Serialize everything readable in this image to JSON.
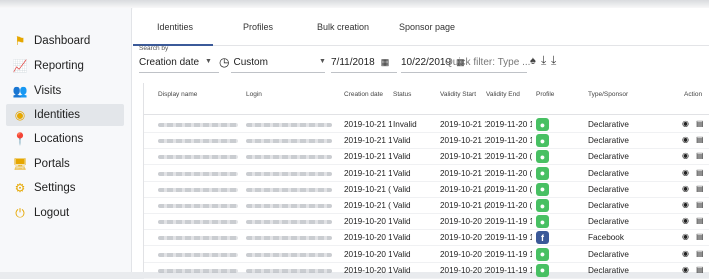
{
  "sidebar": {
    "items": [
      {
        "label": "Dashboard",
        "icon": "dashboard-icon",
        "glyph": "⚑",
        "color": "#e6a700"
      },
      {
        "label": "Reporting",
        "icon": "chart-icon",
        "glyph": "📈",
        "color": "#e6a700"
      },
      {
        "label": "Visits",
        "icon": "people-icon",
        "glyph": "👥",
        "color": "#e6a700"
      },
      {
        "label": "Identities",
        "icon": "fingerprint-icon",
        "glyph": "◉",
        "color": "#e6a700",
        "active": true
      },
      {
        "label": "Locations",
        "icon": "location-pin-icon",
        "glyph": "📍",
        "color": "#e6a700"
      },
      {
        "label": "Portals",
        "icon": "portal-icon",
        "glyph": "🖥",
        "color": "#e6a700"
      },
      {
        "label": "Settings",
        "icon": "gear-icon",
        "glyph": "⚙",
        "color": "#e6a700"
      },
      {
        "label": "Logout",
        "icon": "power-icon",
        "glyph": "⏻",
        "color": "#e6a700"
      }
    ]
  },
  "tabs": [
    "Identities",
    "Profiles",
    "Bulk creation",
    "Sponsor page"
  ],
  "filters": {
    "search_by_label": "Search by",
    "search_by_value": "Creation date",
    "period_value": "Custom",
    "start_date": "7/11/2018",
    "end_date": "10/22/2019",
    "quick_filter_placeholder": "Quick filter: Type ..."
  },
  "table": {
    "headers": [
      "Display name",
      "Login",
      "Creation date",
      "Status",
      "Validity Start",
      "Validity End",
      "Profile",
      "Type/Sponsor",
      "Action"
    ],
    "rows": [
      {
        "creation": "2019-10-21 1",
        "status": "Invalid",
        "vstart": "2019-10-21 1",
        "vend": "2019-11-20 1",
        "profile": "declarative",
        "type": "Declarative"
      },
      {
        "creation": "2019-10-21 1",
        "status": "Valid",
        "vstart": "2019-10-21 1",
        "vend": "2019-11-20 1",
        "profile": "declarative",
        "type": "Declarative"
      },
      {
        "creation": "2019-10-21 1",
        "status": "Valid",
        "vstart": "2019-10-21 1",
        "vend": "2019-11-20 (",
        "profile": "declarative",
        "type": "Declarative"
      },
      {
        "creation": "2019-10-21 1",
        "status": "Valid",
        "vstart": "2019-10-21 1",
        "vend": "2019-11-20 (",
        "profile": "declarative",
        "type": "Declarative"
      },
      {
        "creation": "2019-10-21 (",
        "status": "Valid",
        "vstart": "2019-10-21 (",
        "vend": "2019-11-20 (",
        "profile": "declarative",
        "type": "Declarative"
      },
      {
        "creation": "2019-10-21 (",
        "status": "Valid",
        "vstart": "2019-10-21 (",
        "vend": "2019-11-20 (",
        "profile": "declarative",
        "type": "Declarative"
      },
      {
        "creation": "2019-10-20 1",
        "status": "Valid",
        "vstart": "2019-10-20 1",
        "vend": "2019-11-19 1",
        "profile": "declarative",
        "type": "Declarative"
      },
      {
        "creation": "2019-10-20 1",
        "status": "Valid",
        "vstart": "2019-10-20 1",
        "vend": "2019-11-19 1",
        "profile": "facebook",
        "type": "Facebook"
      },
      {
        "creation": "2019-10-20 1",
        "status": "Valid",
        "vstart": "2019-10-20 1",
        "vend": "2019-11-19 1",
        "profile": "declarative",
        "type": "Declarative"
      },
      {
        "creation": "2019-10-20 1",
        "status": "Valid",
        "vstart": "2019-10-20 1",
        "vend": "2019-11-19 1",
        "profile": "declarative",
        "type": "Declarative"
      }
    ]
  },
  "colors": {
    "accent": "#3b5a99",
    "declarative": "#48c063",
    "facebook": "#3b5998",
    "sidebar_icon": "#e6a700"
  }
}
